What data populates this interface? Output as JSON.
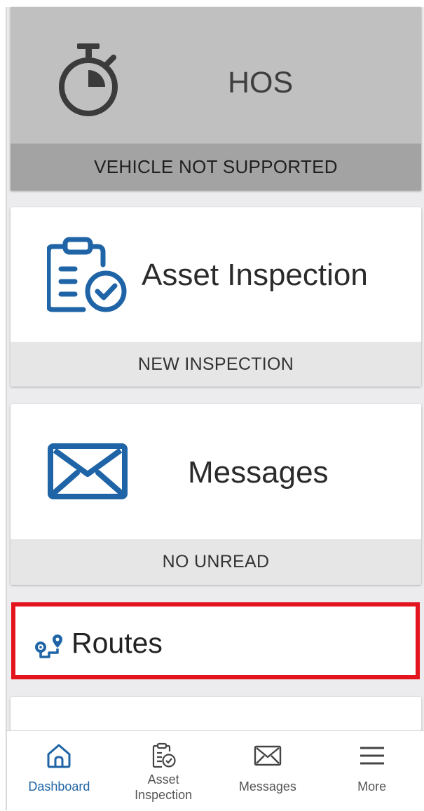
{
  "cards": {
    "hos": {
      "title": "HOS",
      "status": "VEHICLE NOT SUPPORTED",
      "icon": "stopwatch-icon",
      "enabled": false
    },
    "asset_inspection": {
      "title": "Asset Inspection",
      "action": "NEW INSPECTION",
      "icon": "clipboard-check-icon"
    },
    "messages": {
      "title": "Messages",
      "status": "NO UNREAD",
      "icon": "envelope-icon"
    },
    "routes": {
      "title": "Routes",
      "icon": "route-icon",
      "highlighted": true
    }
  },
  "bottom_nav": {
    "items": [
      {
        "label": "Dashboard",
        "icon": "home-icon",
        "active": true
      },
      {
        "label_line1": "Asset",
        "label_line2": "Inspection",
        "icon": "clipboard-check-icon",
        "active": false
      },
      {
        "label": "Messages",
        "icon": "envelope-icon",
        "active": false
      },
      {
        "label": "More",
        "icon": "menu-icon",
        "active": false
      }
    ]
  },
  "colors": {
    "accent": "#1f64a6",
    "highlight": "#e4141f",
    "disabled": "#c0c0c0"
  }
}
